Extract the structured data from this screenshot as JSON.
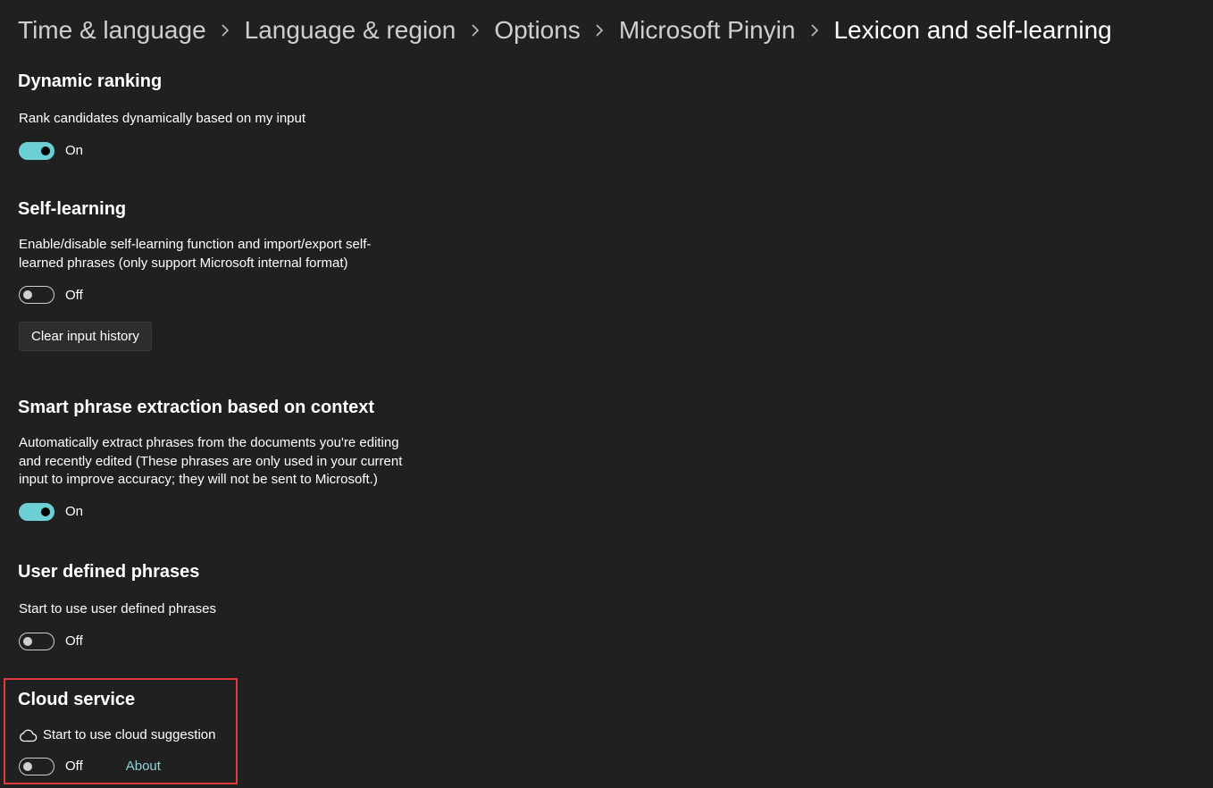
{
  "breadcrumb": [
    {
      "label": "Time & language"
    },
    {
      "label": "Language & region"
    },
    {
      "label": "Options"
    },
    {
      "label": "Microsoft Pinyin"
    },
    {
      "label": "Lexicon and self-learning"
    }
  ],
  "sections": {
    "dynamic_ranking": {
      "title": "Dynamic ranking",
      "description": "Rank candidates dynamically based on my input",
      "toggle_state": "On"
    },
    "self_learning": {
      "title": "Self-learning",
      "description": "Enable/disable self-learning function and import/export self-learned phrases (only support Microsoft internal format)",
      "toggle_state": "Off",
      "button_label": "Clear input history"
    },
    "smart_phrase": {
      "title": "Smart phrase extraction based on context",
      "description": "Automatically extract phrases from the documents you're editing and recently edited (These phrases are only used in your current input to improve accuracy; they will not be sent to Microsoft.)",
      "toggle_state": "On"
    },
    "user_defined": {
      "title": "User defined phrases",
      "description": "Start to use user defined phrases",
      "toggle_state": "Off"
    },
    "cloud_service": {
      "title": "Cloud service",
      "description": "Start to use cloud suggestion",
      "icon": "cloud-icon",
      "toggle_state": "Off",
      "link_label": "About"
    }
  },
  "colors": {
    "background": "#202020",
    "accent": "#6ccfd6",
    "highlight": "#e03a3a",
    "link": "#8fd3dc"
  }
}
